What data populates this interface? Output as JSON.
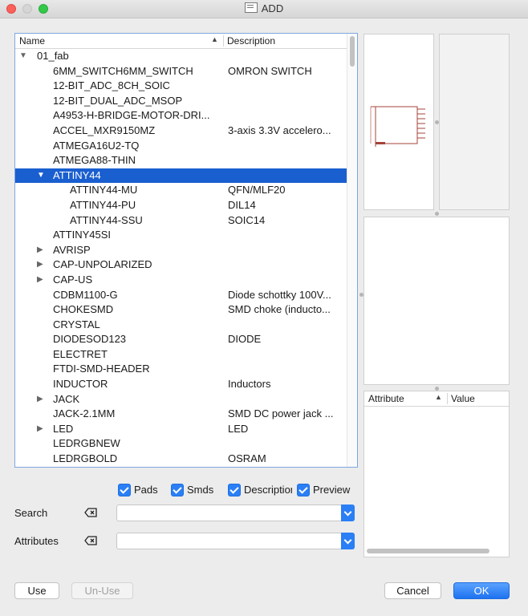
{
  "window": {
    "title": "ADD"
  },
  "tree": {
    "col_name": "Name",
    "col_desc": "Description",
    "rows": [
      {
        "name": "01_fab",
        "desc": "",
        "level": 0,
        "arrow": "▼",
        "selected": false
      },
      {
        "name": "6MM_SWITCH6MM_SWITCH",
        "desc": "OMRON SWITCH",
        "level": 1,
        "arrow": "",
        "selected": false
      },
      {
        "name": "12-BIT_ADC_8CH_SOIC",
        "desc": "",
        "level": 1,
        "arrow": "",
        "selected": false
      },
      {
        "name": "12-BIT_DUAL_ADC_MSOP",
        "desc": "",
        "level": 1,
        "arrow": "",
        "selected": false
      },
      {
        "name": "A4953-H-BRIDGE-MOTOR-DRI...",
        "desc": "",
        "level": 1,
        "arrow": "",
        "selected": false
      },
      {
        "name": "ACCEL_MXR9150MZ",
        "desc": "3-axis 3.3V accelero...",
        "level": 1,
        "arrow": "",
        "selected": false
      },
      {
        "name": "ATMEGA16U2-TQ",
        "desc": "",
        "level": 1,
        "arrow": "",
        "selected": false
      },
      {
        "name": "ATMEGA88-THIN",
        "desc": "",
        "level": 1,
        "arrow": "",
        "selected": false
      },
      {
        "name": "ATTINY44",
        "desc": "",
        "level": 1,
        "arrow": "▼",
        "selected": true
      },
      {
        "name": "ATTINY44-MU",
        "desc": "QFN/MLF20",
        "level": 2,
        "arrow": "",
        "selected": false
      },
      {
        "name": "ATTINY44-PU",
        "desc": "DIL14",
        "level": 2,
        "arrow": "",
        "selected": false
      },
      {
        "name": "ATTINY44-SSU",
        "desc": "SOIC14",
        "level": 2,
        "arrow": "",
        "selected": false
      },
      {
        "name": "ATTINY45SI",
        "desc": "",
        "level": 1,
        "arrow": "",
        "selected": false
      },
      {
        "name": "AVRISP",
        "desc": "",
        "level": 1,
        "arrow": "▶",
        "selected": false
      },
      {
        "name": "CAP-UNPOLARIZED",
        "desc": "",
        "level": 1,
        "arrow": "▶",
        "selected": false
      },
      {
        "name": "CAP-US",
        "desc": "",
        "level": 1,
        "arrow": "▶",
        "selected": false
      },
      {
        "name": "CDBM1100-G",
        "desc": "Diode schottky 100V...",
        "level": 1,
        "arrow": "",
        "selected": false
      },
      {
        "name": "CHOKESMD",
        "desc": "SMD choke (inducto...",
        "level": 1,
        "arrow": "",
        "selected": false
      },
      {
        "name": "CRYSTAL",
        "desc": "",
        "level": 1,
        "arrow": "",
        "selected": false
      },
      {
        "name": "DIODESOD123",
        "desc": "DIODE",
        "level": 1,
        "arrow": "",
        "selected": false
      },
      {
        "name": "ELECTRET",
        "desc": "",
        "level": 1,
        "arrow": "",
        "selected": false
      },
      {
        "name": "FTDI-SMD-HEADER",
        "desc": "",
        "level": 1,
        "arrow": "",
        "selected": false
      },
      {
        "name": "INDUCTOR",
        "desc": "Inductors",
        "level": 1,
        "arrow": "",
        "selected": false
      },
      {
        "name": "JACK",
        "desc": "",
        "level": 1,
        "arrow": "▶",
        "selected": false
      },
      {
        "name": "JACK-2.1MM",
        "desc": "SMD DC power jack ...",
        "level": 1,
        "arrow": "",
        "selected": false
      },
      {
        "name": "LED",
        "desc": "LED",
        "level": 1,
        "arrow": "▶",
        "selected": false
      },
      {
        "name": "LEDRGBNEW",
        "desc": "",
        "level": 1,
        "arrow": "",
        "selected": false
      },
      {
        "name": "LEDRGBOLD",
        "desc": "OSRAM",
        "level": 1,
        "arrow": "",
        "selected": false
      }
    ]
  },
  "attributes_panel": {
    "col_attribute": "Attribute",
    "col_value": "Value"
  },
  "options": {
    "pads": "Pads",
    "smds": "Smds",
    "description": "Description",
    "preview": "Preview"
  },
  "search": {
    "label": "Search",
    "value": ""
  },
  "attributes": {
    "label": "Attributes",
    "value": ""
  },
  "buttons": {
    "use": "Use",
    "unuse": "Un-Use",
    "cancel": "Cancel",
    "ok": "OK"
  },
  "colors": {
    "selection": "#1a5fd0",
    "accent": "#2a7ff5",
    "schematic": "#a4433a"
  }
}
